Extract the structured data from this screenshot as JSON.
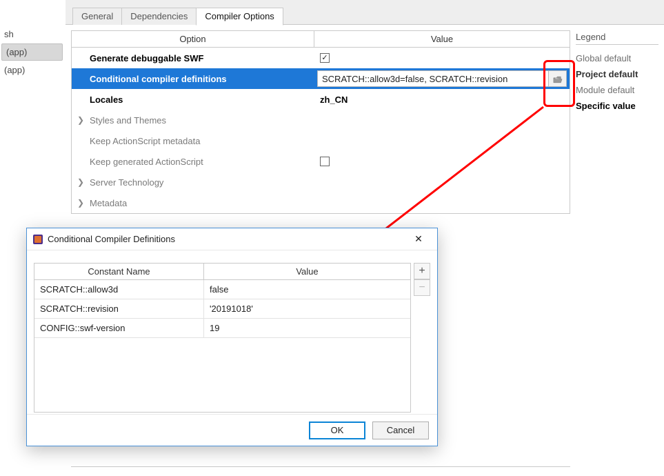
{
  "left_sidebar": {
    "items": [
      {
        "label": "sh"
      },
      {
        "label": "(app)"
      },
      {
        "label": "  (app)"
      }
    ]
  },
  "tabs": {
    "general": "General",
    "dependencies": "Dependencies",
    "compiler_options": "Compiler Options"
  },
  "table": {
    "header_option": "Option",
    "header_value": "Value",
    "rows": {
      "generate_debuggable": {
        "label": "Generate debuggable SWF"
      },
      "conditional_defs": {
        "label": "Conditional compiler definitions",
        "value_text": "SCRATCH::allow3d=false, SCRATCH::revision"
      },
      "locales": {
        "label": "Locales",
        "value": "zh_CN"
      },
      "styles_themes": {
        "label": "Styles and Themes"
      },
      "keep_as_metadata": {
        "label": "Keep ActionScript metadata"
      },
      "keep_generated_as": {
        "label": "Keep generated ActionScript"
      },
      "server_tech": {
        "label": "Server Technology"
      },
      "metadata": {
        "label": "Metadata"
      }
    }
  },
  "legend": {
    "title": "Legend",
    "global_default": "Global default",
    "project_default": "Project default",
    "module_default": "Module default",
    "specific_value": "Specific value"
  },
  "dialog": {
    "title": "Conditional Compiler Definitions",
    "header_name": "Constant Name",
    "header_value": "Value",
    "rows": [
      {
        "name": "SCRATCH::allow3d",
        "value": "false"
      },
      {
        "name": "SCRATCH::revision",
        "value": "'20191018'"
      },
      {
        "name": "CONFIG::swf-version",
        "value": "19"
      }
    ],
    "ok": "OK",
    "cancel": "Cancel"
  }
}
